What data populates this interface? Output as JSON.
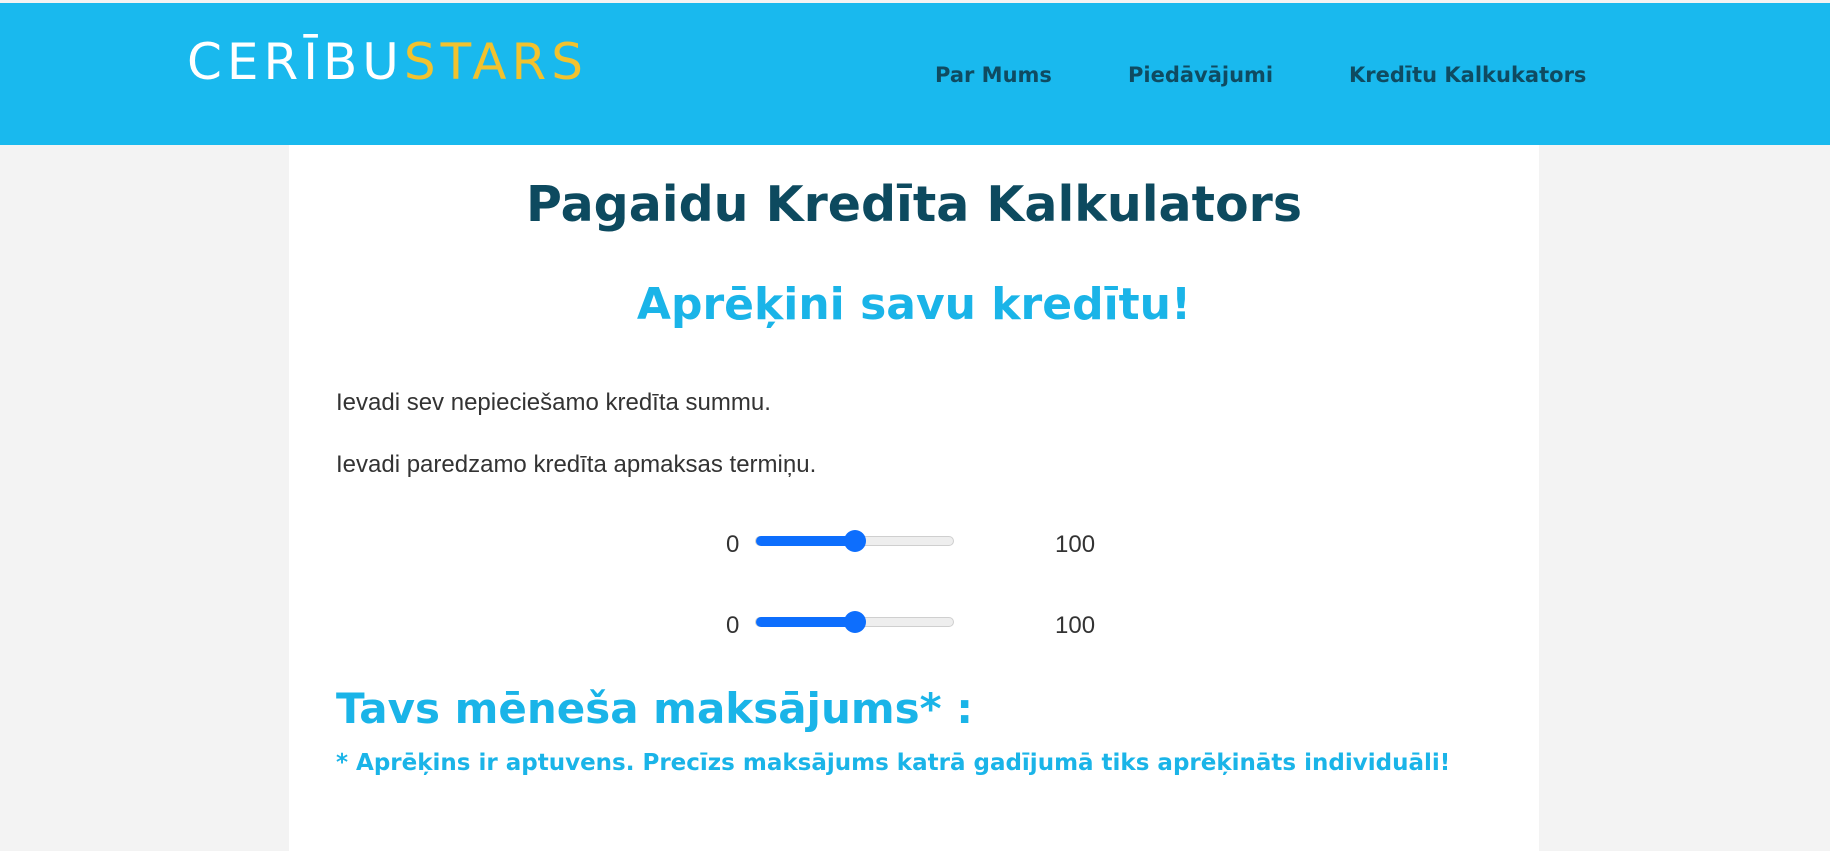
{
  "header": {
    "logo_part1": "CERĪBU",
    "logo_part2": "STARS",
    "nav": [
      {
        "label": "Par Mums"
      },
      {
        "label": "Piedāvājumi"
      },
      {
        "label": "Kredītu Kalkukators"
      }
    ]
  },
  "main": {
    "title": "Pagaidu Kredīta Kalkulators",
    "subtitle": "Aprēķini savu kredītu!",
    "instruction_amount": "Ievadi sev nepieciešamo kredīta summu.",
    "instruction_term": "Ievadi paredzamo kredīta apmaksas termiņu.",
    "sliders": [
      {
        "min": "0",
        "max": "100",
        "value_percent": 50
      },
      {
        "min": "0",
        "max": "100",
        "value_percent": 50
      }
    ],
    "result_label": "Tavs mēneša maksājums* :",
    "disclaimer": "* Aprēķins ir aptuvens. Precīzs maksājums katrā gadījumā tiks aprēķināts individuāli!"
  },
  "colors": {
    "header_bg": "#19b9ee",
    "logo_accent": "#f2c22e",
    "title": "#0d4a5f",
    "accent_text": "#1ab4e8",
    "slider": "#0d6efd"
  }
}
